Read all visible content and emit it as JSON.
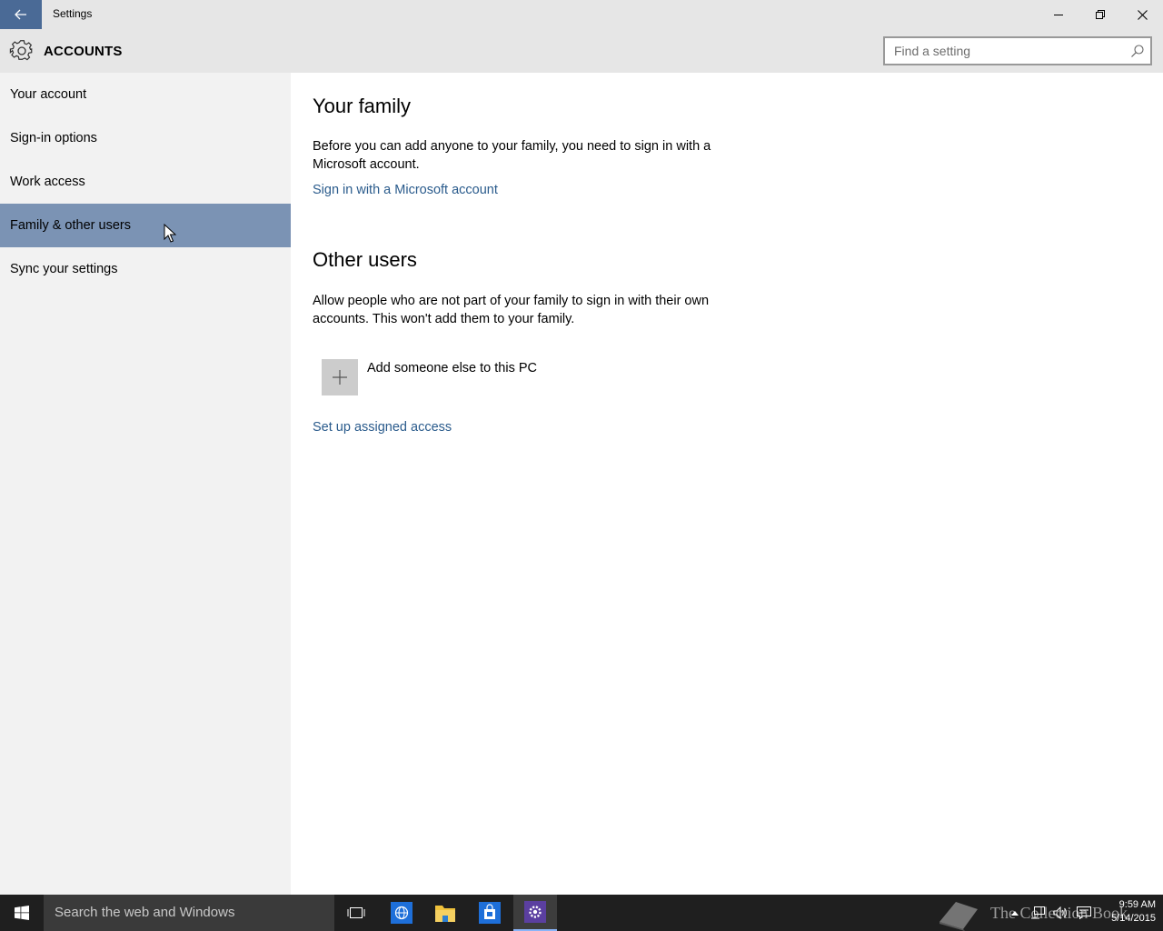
{
  "window": {
    "title": "Settings"
  },
  "header": {
    "title": "ACCOUNTS"
  },
  "search": {
    "placeholder": "Find a setting"
  },
  "sidebar": {
    "items": [
      {
        "label": "Your account",
        "selected": false
      },
      {
        "label": "Sign-in options",
        "selected": false
      },
      {
        "label": "Work access",
        "selected": false
      },
      {
        "label": "Family & other users",
        "selected": true
      },
      {
        "label": "Sync your settings",
        "selected": false
      }
    ]
  },
  "main": {
    "family": {
      "title": "Your family",
      "description": "Before you can add anyone to your family, you need to sign in with a Microsoft account.",
      "link": "Sign in with a Microsoft account"
    },
    "other_users": {
      "title": "Other users",
      "description": "Allow people who are not part of your family to sign in with their own accounts. This won't add them to your family.",
      "add_label": "Add someone else to this PC",
      "assigned_access_link": "Set up assigned access"
    }
  },
  "taskbar": {
    "search_placeholder": "Search the web and Windows",
    "time": "9:59 AM",
    "date": "5/14/2015",
    "watermark": "The Collection Book"
  },
  "colors": {
    "accent": "#4a6a96",
    "selected_nav": "#7b93b4",
    "link": "#2a5b8c",
    "sidebar_bg": "#f2f2f2",
    "header_bg": "#e6e6e6",
    "taskbar_bg": "#1f1f1f"
  },
  "icons": {
    "back": "arrow-left-icon",
    "header": "gear-icon",
    "search": "search-icon",
    "add": "plus-icon",
    "start": "windows-logo-icon",
    "task_view": "task-view-icon",
    "browser": "globe-icon",
    "explorer": "folder-icon",
    "store": "store-bag-icon",
    "settings": "gear-icon"
  }
}
